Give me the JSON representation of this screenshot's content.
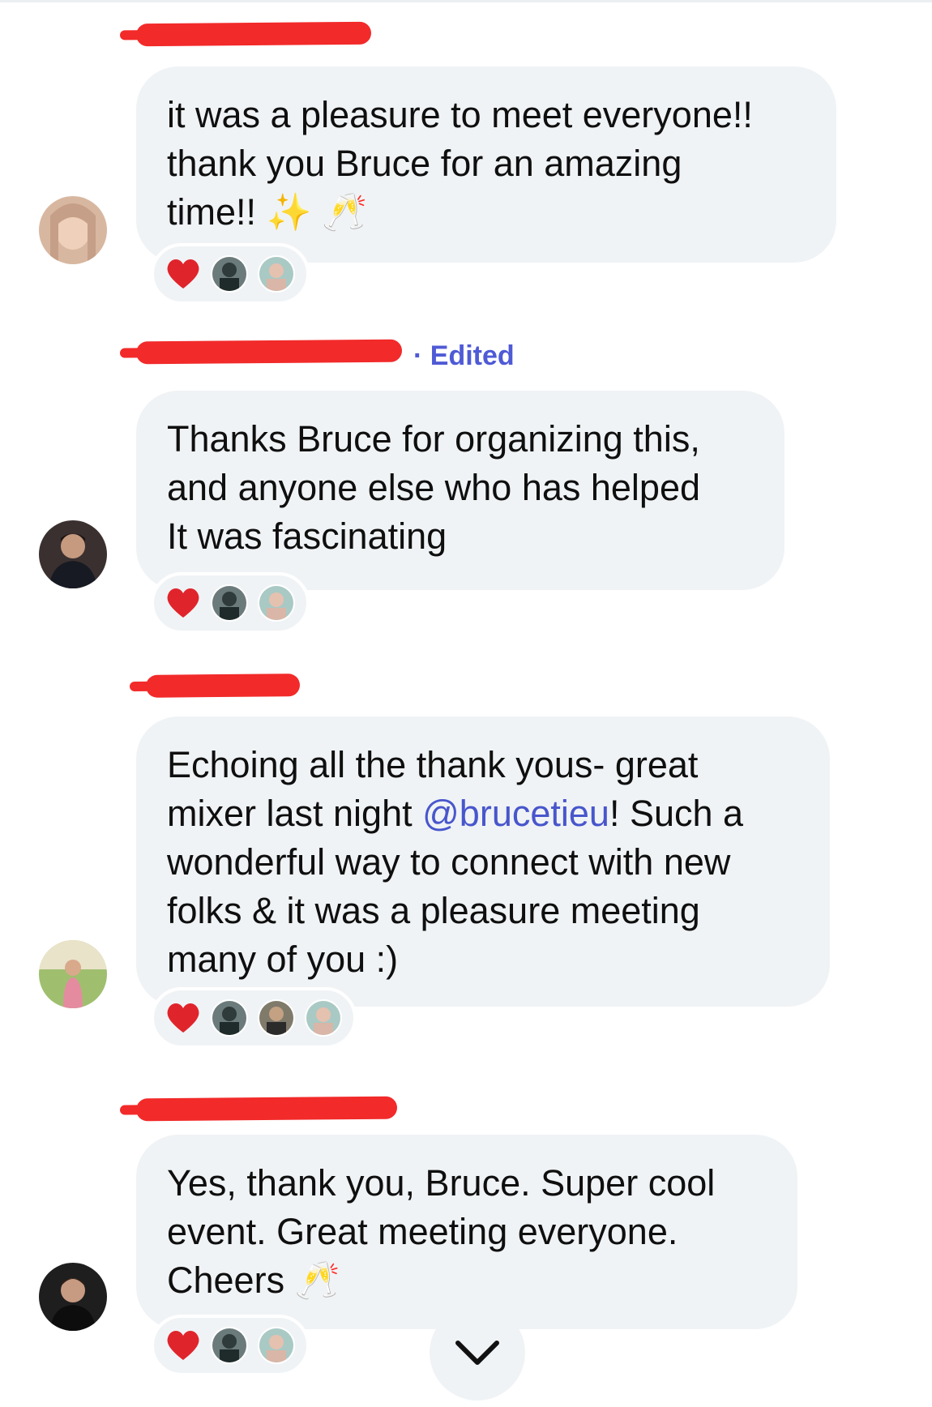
{
  "messages": [
    {
      "author": "redacted",
      "edited_label": "",
      "lines": [
        "it was a pleasure to meet everyone!!",
        "thank you Bruce for an amazing",
        "time!!"
      ],
      "emoji": "✨ 🥂",
      "reactions": [
        "heart-reaction",
        "avatar-1",
        "avatar-2"
      ]
    },
    {
      "author": "redacted",
      "edited_label": "· Edited",
      "lines": [
        "Thanks Bruce for organizing this,",
        "and anyone else who has helped",
        "It was fascinating"
      ],
      "emoji": "",
      "reactions": [
        "heart-reaction",
        "avatar-1",
        "avatar-2"
      ]
    },
    {
      "author": "redacted",
      "edited_label": "",
      "line1": "Echoing all the thank yous- great",
      "line2_pre": "mixer last night ",
      "mention": "@brucetieu",
      "line2_post": "! Such a",
      "line3": "wonderful way to connect with new",
      "line4": "folks & it was a pleasure meeting",
      "line5": "many of you :)",
      "reactions": [
        "heart-reaction",
        "avatar-1",
        "avatar-3",
        "avatar-2"
      ]
    },
    {
      "author": "redacted",
      "edited_label": "",
      "lines": [
        "Yes, thank you, Bruce. Super cool",
        "event. Great meeting everyone.",
        "Cheers"
      ],
      "emoji": "🥂",
      "reactions": [
        "heart-reaction",
        "avatar-1",
        "avatar-2"
      ]
    }
  ],
  "scroll_button_icon": "chevron-down-icon",
  "colors": {
    "bubble": "#f0f3f5",
    "mention": "#4856cc",
    "edited": "#4f5ad6",
    "heart": "#e0242c"
  }
}
